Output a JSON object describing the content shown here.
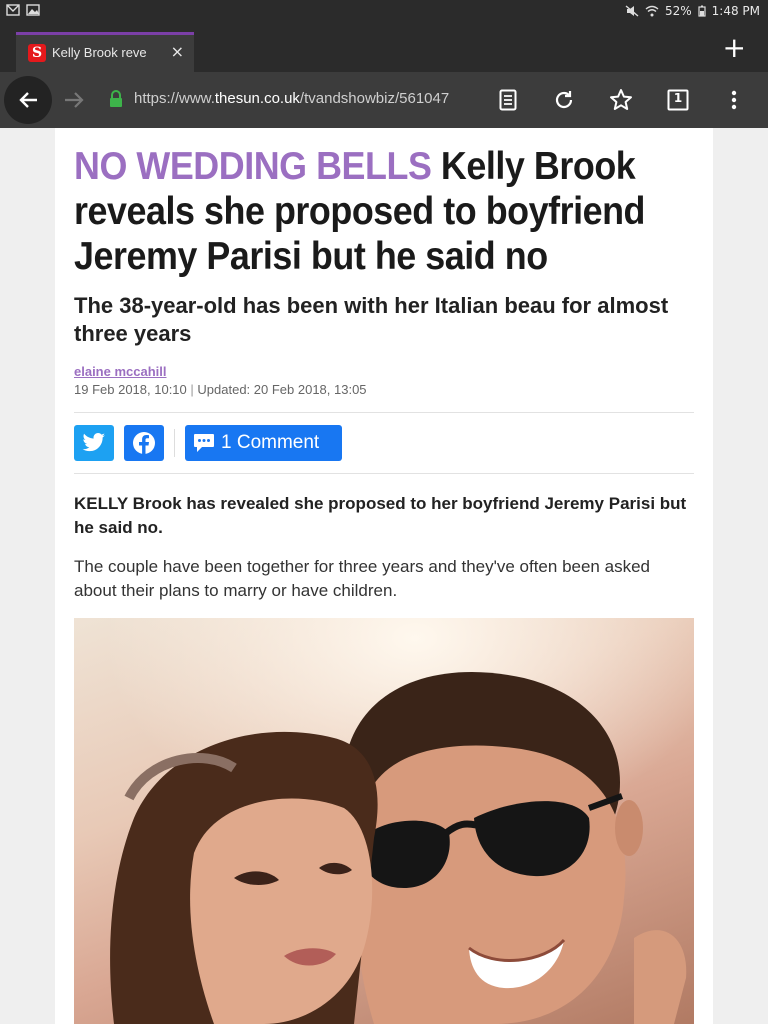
{
  "status_bar": {
    "battery": "52%",
    "time": "1:48 PM"
  },
  "tab": {
    "favicon_letter": "S",
    "title": "Kelly Brook reve",
    "close": "×"
  },
  "new_tab": "+",
  "address": {
    "scheme": "https://www.",
    "host": "thesun.co.uk",
    "path": "/tvandshowbiz/561047"
  },
  "toolbar": {
    "tab_count": "1"
  },
  "article": {
    "kicker": "NO WEDDING BELLS",
    "headline": "Kelly Brook reveals she proposed to boyfriend Jeremy Parisi but he said no",
    "subheadline": "The 38-year-old has been with her Italian beau for almost three years",
    "author": "elaine mccahill",
    "published": "19 Feb 2018, 10:10",
    "updated": "Updated: 20 Feb 2018, 13:05",
    "comments_label": "1 Comment",
    "lead": "KELLY Brook has revealed she proposed to her boyfriend Jeremy Parisi but he said no.",
    "paragraph": "The couple have been together for three years and they've often been asked about their plans to marry or have children."
  },
  "colors": {
    "kicker": "#9b6fc1",
    "twitter": "#1da1f2",
    "facebook": "#1877f2",
    "tab_accent": "#7b3fa7"
  }
}
